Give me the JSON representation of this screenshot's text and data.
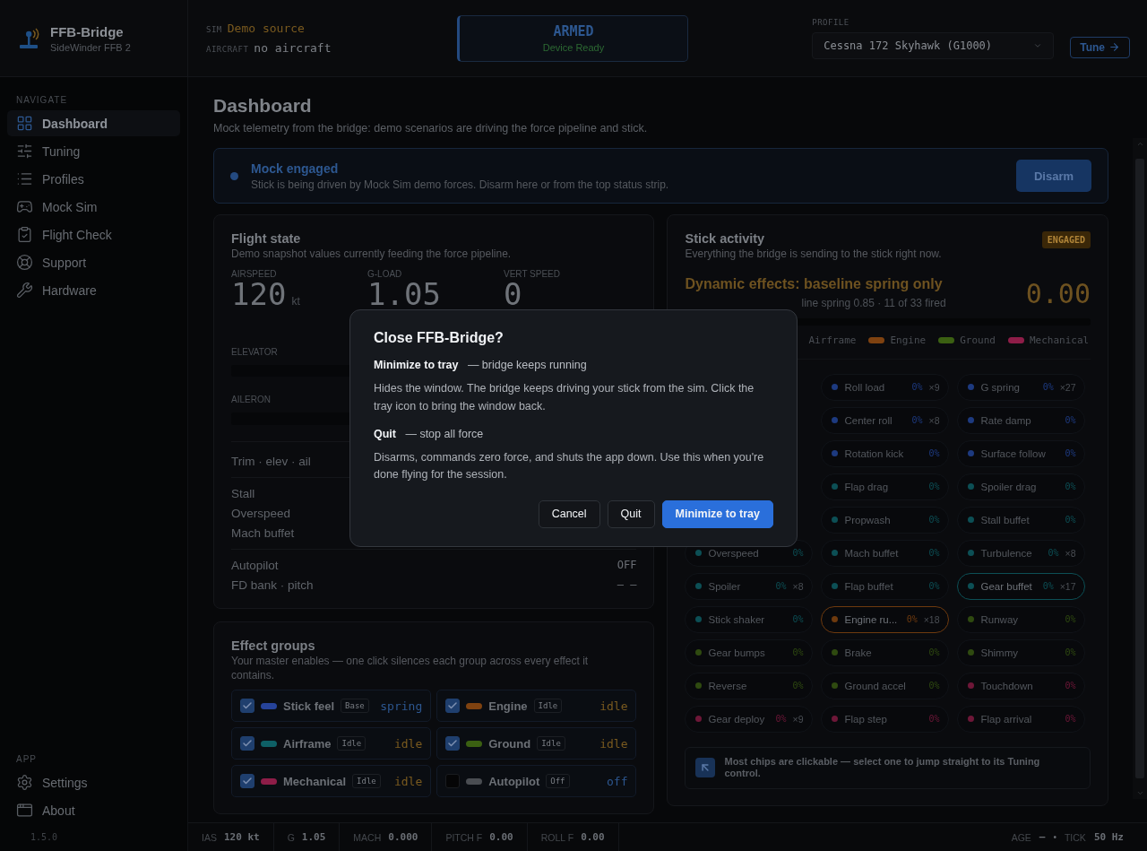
{
  "app": {
    "name": "FFB-Bridge",
    "device": "SideWinder FFB 2"
  },
  "status": {
    "sim_label": "SIM",
    "sim": "Demo source",
    "aircraft_label": "AIRCRAFT",
    "aircraft": "no aircraft",
    "state": "ARMED",
    "state_detail": "Device Ready",
    "profile_label": "PROFILE",
    "profile": "Cessna 172 Skyhawk (G1000)",
    "tune": "Tune"
  },
  "sidebar": {
    "sections": [
      {
        "title": "NAVIGATE",
        "items": [
          {
            "label": "Dashboard",
            "selected": true
          },
          {
            "label": "Tuning",
            "selected": false
          },
          {
            "label": "Profiles",
            "selected": false
          },
          {
            "label": "Mock Sim",
            "selected": false
          },
          {
            "label": "Flight Check",
            "selected": false
          },
          {
            "label": "Support",
            "selected": false
          },
          {
            "label": "Hardware",
            "selected": false
          }
        ]
      },
      {
        "title": "APP",
        "items": [
          {
            "label": "Settings",
            "selected": false
          },
          {
            "label": "About",
            "selected": false
          }
        ]
      }
    ],
    "version": "1.5.0"
  },
  "page": {
    "title": "Dashboard",
    "subtitle": "Mock telemetry from the bridge: demo scenarios are driving the force pipeline and stick."
  },
  "banner": {
    "title": "Mock engaged",
    "text": "Stick is being driven by Mock Sim demo forces. Disarm here or from the top status strip.",
    "button": "Disarm"
  },
  "flight_state": {
    "title": "Flight state",
    "subtitle": "Demo snapshot values currently feeding the force pipeline.",
    "readouts": [
      {
        "label": "AIRSPEED",
        "value": "120",
        "unit": "kt"
      },
      {
        "label": "G-LOAD",
        "value": "1.05"
      },
      {
        "label": "VERT SPEED",
        "value": "0"
      }
    ],
    "bars": [
      {
        "label": "ELEVATOR"
      },
      {
        "label": "AILERON"
      }
    ],
    "row_groups": [
      [
        {
          "label": "Trim · elev · ail"
        }
      ],
      [
        {
          "label": "Stall"
        },
        {
          "label": "Overspeed"
        },
        {
          "label": "Mach buffet"
        }
      ],
      [
        {
          "label": "Autopilot",
          "value": "OFF"
        },
        {
          "label": "FD bank · pitch",
          "value": "– –"
        }
      ]
    ]
  },
  "effect_groups": {
    "title": "Effect groups",
    "subtitle": "Your master enables — one click silences each group across every effect it contains.",
    "items": [
      {
        "name": "Stick feel",
        "checked": true,
        "color": "#26439a",
        "tag": "Base",
        "state": "spring",
        "kind": "active"
      },
      {
        "name": "Engine",
        "checked": true,
        "color": "#7f4210",
        "tag": "Idle",
        "state": "idle",
        "kind": "idle"
      },
      {
        "name": "Airframe",
        "checked": true,
        "color": "#0e6066",
        "tag": "Idle",
        "state": "idle",
        "kind": "idle"
      },
      {
        "name": "Ground",
        "checked": true,
        "color": "#3b6012",
        "tag": "Idle",
        "state": "idle",
        "kind": "idle"
      },
      {
        "name": "Mechanical",
        "checked": true,
        "color": "#8e1d48",
        "tag": "Idle",
        "state": "idle",
        "kind": "idle"
      },
      {
        "name": "Autopilot",
        "checked": false,
        "color": "#4a4d52",
        "tag": "Off",
        "state": "off",
        "kind": "off"
      }
    ]
  },
  "stick_activity": {
    "title": "Stick activity",
    "subtitle": "Everything the bridge is sending to the stick right now.",
    "badge": "ENGAGED",
    "headline": "Dynamic effects: baseline spring only",
    "detail": "line spring 0.85 · 11 of 33 fired",
    "value": "0.00",
    "legend": [
      {
        "name": "Airframe"
      },
      {
        "name": "Engine",
        "color": "#7f4210"
      },
      {
        "name": "Ground",
        "color": "#3b6012"
      },
      {
        "name": "Mechanical",
        "color": "#8e1d48"
      }
    ],
    "chip_rows": [
      [
        {
          "name": "Roll load",
          "pct": "0%",
          "count": "×9",
          "color": "#1d3a80",
          "active": false
        },
        {
          "name": "G spring",
          "pct": "0%",
          "count": "×27",
          "color": "#1d3a80",
          "active": false
        }
      ],
      [
        {
          "name": "Center roll",
          "pct": "0%",
          "count": "×8",
          "color": "#1d3a80",
          "active": false
        },
        {
          "name": "Rate damp",
          "pct": "0%",
          "color": "#1d3a80",
          "active": false
        }
      ],
      [
        {
          "name": "Rotation kick",
          "pct": "0%",
          "color": "#1d3a80",
          "active": false
        },
        {
          "name": "Surface follow",
          "pct": "0%",
          "color": "#1d3a80",
          "active": false
        }
      ],
      [
        {
          "name": "Flap drag",
          "pct": "0%",
          "color": "#0c4f55",
          "active": false
        },
        {
          "name": "Spoiler drag",
          "pct": "0%",
          "color": "#0c4f55",
          "active": false
        }
      ],
      [
        {
          "name": "Propwash",
          "pct": "0%",
          "color": "#0c4f55",
          "active": false
        },
        {
          "name": "Stall buffet",
          "pct": "0%",
          "color": "#0c4f55",
          "active": false
        }
      ],
      [
        {
          "name": "Overspeed",
          "pct": "0%",
          "color": "#0c4f55",
          "active": false
        },
        {
          "name": "Mach buffet",
          "pct": "0%",
          "color": "#0c4f55",
          "active": false
        },
        {
          "name": "Turbulence",
          "pct": "0%",
          "count": "×8",
          "color": "#0c4f55",
          "active": false
        }
      ],
      [
        {
          "name": "Spoiler",
          "pct": "0%",
          "count": "×8",
          "color": "#0c4f55",
          "active": false
        },
        {
          "name": "Flap buffet",
          "pct": "0%",
          "color": "#0c4f55",
          "active": false
        },
        {
          "name": "Gear buffet",
          "pct": "0%",
          "count": "×17",
          "color": "#0c4f55",
          "active": true
        }
      ],
      [
        {
          "name": "Stick shaker",
          "pct": "0%",
          "color": "#0c4f55",
          "active": false
        },
        {
          "name": "Engine ru...",
          "pct": "0%",
          "count": "×18",
          "color": "#6e3a0e",
          "active": true
        },
        {
          "name": "Runway",
          "pct": "0%",
          "color": "#2f4a10",
          "active": false
        }
      ],
      [
        {
          "name": "Gear bumps",
          "pct": "0%",
          "color": "#2f4a10",
          "active": false
        },
        {
          "name": "Brake",
          "pct": "0%",
          "color": "#2f4a10",
          "active": false
        },
        {
          "name": "Shimmy",
          "pct": "0%",
          "color": "#2f4a10",
          "active": false
        }
      ],
      [
        {
          "name": "Reverse",
          "pct": "0%",
          "color": "#2f4a10",
          "active": false
        },
        {
          "name": "Ground accel",
          "pct": "0%",
          "color": "#2f4a10",
          "active": false
        },
        {
          "name": "Touchdown",
          "pct": "0%",
          "color": "#6e1738",
          "active": false
        }
      ],
      [
        {
          "name": "Gear deploy",
          "pct": "0%",
          "count": "×9",
          "color": "#6e1738",
          "active": false
        },
        {
          "name": "Flap step",
          "pct": "0%",
          "color": "#6e1738",
          "active": false
        },
        {
          "name": "Flap arrival",
          "pct": "0%",
          "color": "#6e1738",
          "active": false
        }
      ]
    ],
    "tip": "Most chips are clickable — select one to jump straight to its Tuning control."
  },
  "status_bar": {
    "left": [
      {
        "label": "IAS",
        "value": "120 kt"
      },
      {
        "label": "G",
        "value": "1.05"
      },
      {
        "label": "MACH",
        "value": "0.000"
      },
      {
        "label": "PITCH F",
        "value": "0.00"
      },
      {
        "label": "ROLL F",
        "value": "0.00"
      }
    ],
    "right": [
      {
        "label": "AGE",
        "value": "—"
      },
      {
        "label": "TICK",
        "value": "50 Hz"
      }
    ],
    "separator": "•"
  },
  "dialog": {
    "title": "Close FFB-Bridge?",
    "sections": [
      {
        "heading": "Minimize to tray",
        "note": "— bridge keeps running",
        "text": "Hides the window. The bridge keeps driving your stick from the sim. Click the tray icon to bring the window back."
      },
      {
        "heading": "Quit",
        "note": "— stop all force",
        "text": "Disarms, commands zero force, and shuts the app down. Use this when you're done flying for the session."
      }
    ],
    "buttons": [
      {
        "label": "Cancel",
        "kind": "secondary"
      },
      {
        "label": "Quit",
        "kind": "secondary"
      },
      {
        "label": "Minimize to tray",
        "kind": "primary"
      }
    ]
  }
}
